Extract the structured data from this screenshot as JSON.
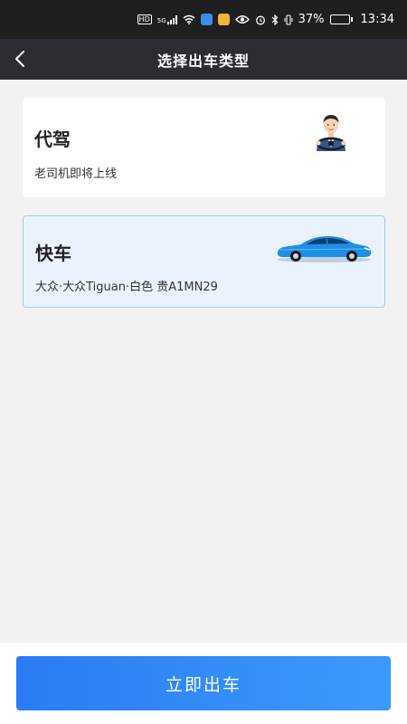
{
  "status_bar": {
    "hd_label": "HD",
    "network_label": "5G",
    "battery": "37%",
    "battery_level": 0.37,
    "time": "13:34"
  },
  "nav": {
    "title": "选择出车类型"
  },
  "options": [
    {
      "title": "代驾",
      "subtitle": "老司机即将上线",
      "icon": "driver-icon",
      "selected": false
    },
    {
      "title": "快车",
      "subtitle": "大众·大众Tiguan·白色   贵A1MN29",
      "icon": "car-icon",
      "selected": true
    }
  ],
  "bottom": {
    "start_label": "立即出车"
  },
  "colors": {
    "status_bar": "#1f1f1f",
    "nav_bar": "#2b2d33",
    "selected_card_bg": "#eaf3fd",
    "selected_card_border": "#a9c8e8",
    "button_gradient_start": "#2b7bf4",
    "button_gradient_end": "#3a9bfb"
  }
}
